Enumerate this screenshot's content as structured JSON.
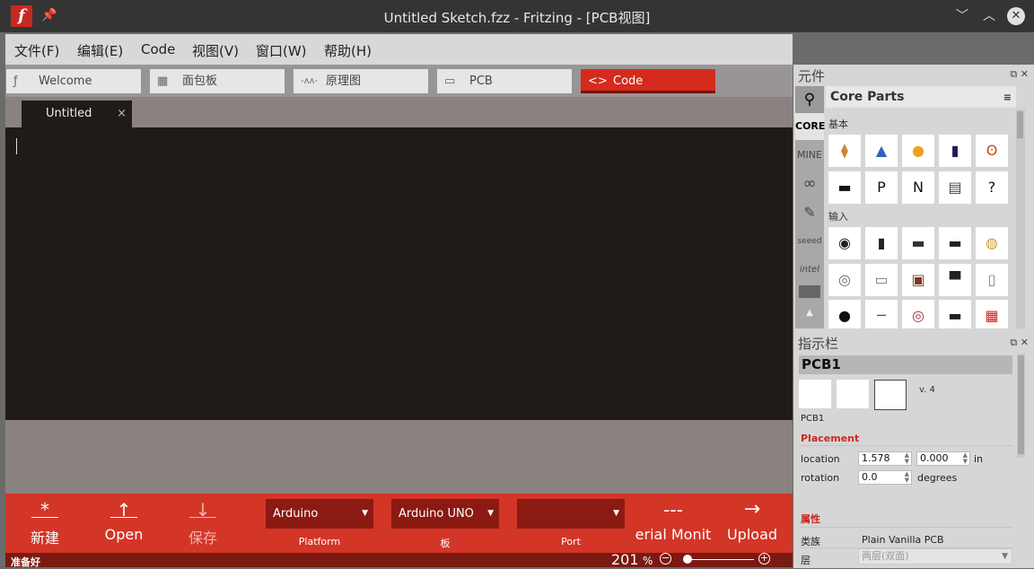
{
  "window": {
    "logo": "f",
    "title": "Untitled Sketch.fzz - Fritzing - [PCB视图]",
    "minimize": "﹀",
    "maximize": "︿",
    "close": "✕"
  },
  "menubar": [
    "文件(F)",
    "编辑(E)",
    "Code",
    "视图(V)",
    "窗口(W)",
    "帮助(H)"
  ],
  "tabs": [
    {
      "label": "Welcome",
      "icon": "fritzing-icon",
      "glyph": "ƒ"
    },
    {
      "label": "面包板",
      "icon": "breadboard-icon",
      "glyph": "▦"
    },
    {
      "label": "原理图",
      "icon": "schematic-icon",
      "glyph": "-ᴧᴧ-"
    },
    {
      "label": "PCB",
      "icon": "pcb-icon",
      "glyph": "▭"
    },
    {
      "label": "Code",
      "icon": "code-icon",
      "glyph": "<>"
    }
  ],
  "editor": {
    "file_tab": "Untitled",
    "file_tab_close": "×"
  },
  "toolbar": {
    "new": {
      "label": "新建",
      "glyph": "*"
    },
    "open": {
      "label": "Open",
      "glyph": "↑"
    },
    "save": {
      "label": "保存",
      "glyph": "↓"
    },
    "platform": {
      "value": "Arduino",
      "label": "Platform"
    },
    "board": {
      "value": "Arduino UNO",
      "label": "板"
    },
    "port": {
      "value": "",
      "label": "Port"
    },
    "serial": {
      "label": "erial Monit",
      "glyph": "---"
    },
    "upload": {
      "label": "Upload",
      "glyph": "→"
    }
  },
  "statusbar": {
    "status": "准备好",
    "zoom": "201",
    "zoom_unit": "%",
    "zoom_out": "−",
    "zoom_in": "+"
  },
  "parts_panel": {
    "title": "元件",
    "bin_title": "Core Parts",
    "bin_menu": "≡",
    "search_glyph": "⚲",
    "bins": [
      "CORE",
      "MINE",
      "∞",
      "✎",
      "seeed",
      "intel",
      "",
      "▲"
    ],
    "section_basic": "基本",
    "section_input": "输入",
    "parts": [
      {
        "icon": "resistor-icon",
        "glyph": "⧫",
        "color": "#c8883a"
      },
      {
        "icon": "ceramic-capacitor-icon",
        "glyph": "▲",
        "color": "#2c63c0"
      },
      {
        "icon": "tantalum-capacitor-icon",
        "glyph": "●",
        "color": "#f0a020"
      },
      {
        "icon": "electrolytic-capacitor-icon",
        "glyph": "▮",
        "color": "#1d1d55"
      },
      {
        "icon": "inductor-icon",
        "glyph": "ʘ",
        "color": "#c84a1e"
      },
      {
        "icon": "diode-icon",
        "glyph": "▬",
        "color": "#111111"
      },
      {
        "icon": "pnp-transistor-icon",
        "glyph": "P",
        "color": "#111111"
      },
      {
        "icon": "npn-transistor-icon",
        "glyph": "N",
        "color": "#111111"
      },
      {
        "icon": "fet-icon",
        "glyph": "▤",
        "color": "#444444"
      },
      {
        "icon": "mystery-part-icon",
        "glyph": "?",
        "color": "#111111"
      },
      {
        "icon": "rotary-encoder-icon",
        "glyph": "◉",
        "color": "#222222"
      },
      {
        "icon": "potentiometer-icon",
        "glyph": "▮",
        "color": "#222222"
      },
      {
        "icon": "slide-pot-icon",
        "glyph": "▬",
        "color": "#333333"
      },
      {
        "icon": "header-icon",
        "glyph": "▬",
        "color": "#222222"
      },
      {
        "icon": "piezo-icon",
        "glyph": "◍",
        "color": "#c8a030"
      },
      {
        "icon": "rotary-pot-icon",
        "glyph": "◎",
        "color": "#666666"
      },
      {
        "icon": "reed-switch-icon",
        "glyph": "▭",
        "color": "#777777"
      },
      {
        "icon": "pushbutton-icon",
        "glyph": "▣",
        "color": "#7a3a20"
      },
      {
        "icon": "slide-switch-icon",
        "glyph": "▀",
        "color": "#222222"
      },
      {
        "icon": "tilt-switch-icon",
        "glyph": "▯",
        "color": "#888888"
      },
      {
        "icon": "ldr-icon",
        "glyph": "●",
        "color": "#111111"
      },
      {
        "icon": "wire-icon",
        "glyph": "─",
        "color": "#555555"
      },
      {
        "icon": "photocell-icon",
        "glyph": "◎",
        "color": "#aa3344"
      },
      {
        "icon": "module-icon",
        "glyph": "▬",
        "color": "#222222"
      },
      {
        "icon": "sensor-board-icon",
        "glyph": "▦",
        "color": "#cc2222"
      }
    ]
  },
  "inspector": {
    "title": "指示栏",
    "part_title": "PCB1",
    "version": "v. 4",
    "title_small": "PCB1",
    "placement_header": "Placement",
    "location_label": "location",
    "location_x": "1.578",
    "location_y": "0.000",
    "location_unit": "in",
    "rotation_label": "rotation",
    "rotation_value": "0.0",
    "rotation_unit": "degrees",
    "properties_header": "属性",
    "family_label": "类族",
    "family_value": "Plain Vanilla PCB",
    "layer_label": "层",
    "layer_value": "两层(双面)"
  },
  "colors": {
    "accent": "#d42b1e",
    "dark_accent": "#7a1a12",
    "editor_bg": "#1e1b19"
  }
}
